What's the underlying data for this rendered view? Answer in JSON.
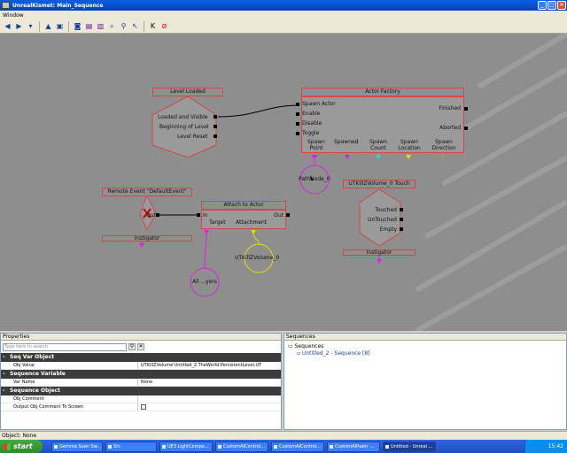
{
  "window": {
    "title": "UnrealKismet: Main_Sequence",
    "menu": [
      "Window"
    ]
  },
  "canvas": {
    "nodes": {
      "level_loaded": {
        "title": "Level Loaded",
        "outputs": [
          "Loaded and Visible",
          "Beginning of Level",
          "Level Reset"
        ]
      },
      "actor_factory": {
        "title": "Actor Factory",
        "inputs": [
          "Spawn Actor",
          "Enable",
          "Disable",
          "Toggle"
        ],
        "outputs": [
          "Finished",
          "Aborted"
        ],
        "vars": [
          "Spawn Point",
          "Spawned",
          "Spawn Count",
          "Spawn Location",
          "Spawn Direction"
        ]
      },
      "remote_event": {
        "title": "Remote Event \"DefaultEvent\"",
        "output": "Out",
        "var": "Instigator"
      },
      "attach_to_actor": {
        "title": "Attach to Actor",
        "input": "In",
        "output": "Out",
        "vars": [
          "Target",
          "Attachment"
        ]
      },
      "touch": {
        "title": "UTKillZVolume_0 Touch",
        "outputs": [
          "Touched",
          "UnTouched",
          "Empty"
        ],
        "var": "Instigator"
      }
    },
    "variables": {
      "path_node": "PathNode_0",
      "all_players": "All ...yers",
      "killz_volume": "UTKillZVolume_0"
    }
  },
  "properties": {
    "header": "Properties",
    "search_placeholder": "Type here to search",
    "sections": [
      {
        "title": "Seq Var Object",
        "rows": [
          {
            "name": "Obj Value",
            "value": "UTKillZVolume'Untitled_2.TheWorld:PersistentLevel.UT"
          }
        ]
      },
      {
        "title": "Sequence Variable",
        "rows": [
          {
            "name": "Var Name",
            "value": "None"
          }
        ]
      },
      {
        "title": "Sequence Object",
        "rows": [
          {
            "name": "Obj Comment",
            "value": ""
          },
          {
            "name": "Output Obj Comment To Screen",
            "value": ""
          }
        ]
      }
    ]
  },
  "sequences": {
    "header": "Sequences",
    "root": "Sequences",
    "child": "Untitled_2 - Sequence [8]"
  },
  "status": {
    "text": "Object: None"
  },
  "taskbar": {
    "start": "start",
    "tasks": [
      "Gemma Suen Sw...",
      "Src",
      "UE3 LightCompo...",
      "CustomAIControl...",
      "CustomAIControl...",
      "CustomAIPawn -...",
      "Untitled - Unreal ..."
    ],
    "clock": "15:42"
  },
  "colors": {
    "title_blue": "#0a5fe0",
    "node_border": "#d04848",
    "canvas": "#8e8e8e",
    "event_link": "#e020e0",
    "object_var": "#e020e0",
    "attachment_var": "#e0e000",
    "int_var": "#40d0d0"
  }
}
